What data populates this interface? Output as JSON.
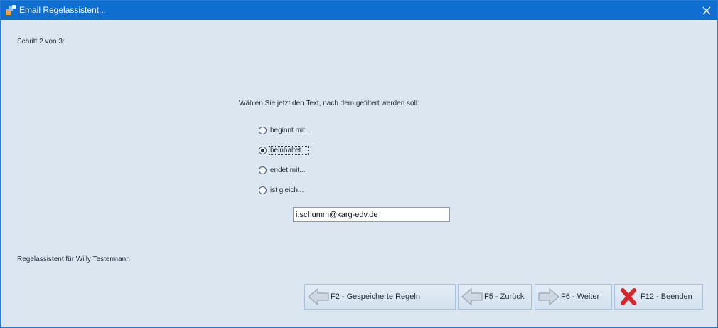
{
  "window": {
    "title": "Email Regelassistent..."
  },
  "step": {
    "label": "Schritt 2 von 3:"
  },
  "prompt": {
    "text": "Wählen Sie jetzt den Text, nach dem gefiltert werden soll:"
  },
  "options": [
    {
      "label": "beginnt mit...",
      "checked": false
    },
    {
      "label": "beinhaltet...",
      "checked": true
    },
    {
      "label": "endet mit...",
      "checked": false
    },
    {
      "label": "ist gleich...",
      "checked": false
    }
  ],
  "filter_input": {
    "value": "i.schumm@karg-edv.de"
  },
  "footer": {
    "owner_text": "Regelassistent für Willy Testermann"
  },
  "buttons": {
    "saved_rules": "F2 - Gespeicherte Regeln",
    "back": "F5 - Zurück",
    "next": "F6 - Weiter",
    "exit_prefix": "F12 - ",
    "exit_underlined": "B",
    "exit_suffix": "eenden"
  },
  "icons": {
    "app": "app-icon",
    "close": "close-icon",
    "back_arrow": "arrow-left-icon",
    "next_arrow": "arrow-right-icon",
    "exit": "red-x-icon"
  },
  "colors": {
    "titlebar": "#0f6fd0",
    "client_bg": "#dce6f1",
    "exit_icon": "#d9262b"
  }
}
